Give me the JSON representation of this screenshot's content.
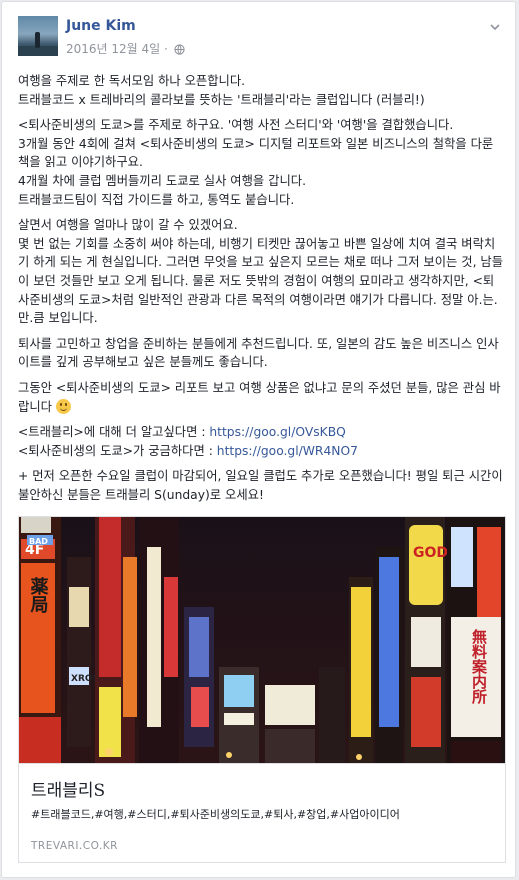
{
  "author": {
    "name": "June Kim",
    "timestamp": "2016년 12월 4일",
    "separator": "·",
    "privacy_icon": "globe-icon"
  },
  "post": {
    "p1": "여행을 주제로 한 독서모임 하나 오픈합니다.",
    "p2": "트래블코드 x 트레바리의 콜라보를 뜻하는 '트래블리'라는 클럽입니다 (러블리!)",
    "p3": "<퇴사준비생의 도쿄>를 주제로 하구요. '여행 사전 스터디'와 '여행'을 결합했습니다.",
    "p4": "3개월 동안 4회에 걸쳐 <퇴사준비생의 도쿄> 디지털 리포트와 일본 비즈니스의 철학을 다룬 책을 읽고 이야기하구요.",
    "p5": "4개월 차에 클럽 멤버들끼리 도쿄로 실사 여행을 갑니다.",
    "p6": "트래블코드팀이 직접 가이드를 하고, 통역도 붙습니다.",
    "p7": "살면서 여행을 얼마나 많이 갈 수 있겠어요.",
    "p8": "몇 번 없는 기회를 소중히 써야 하는데, 비행기 티켓만 끊어놓고 바쁜 일상에 치여 결국 벼락치기 하게 되는 게 현실입니다. 그러면 무엇을 보고 싶은지 모르는 채로 떠나 그저 보이는 것, 남들이 보던 것들만 보고 오게 됩니다. 물론 저도 뜻밖의 경험이 여행의 묘미라고 생각하지만, <퇴사준비생의 도쿄>처럼 일반적인 관광과 다른 목적의 여행이라면 얘기가 다릅니다. 정말 아.는.만.큼 보입니다.",
    "p9": "퇴사를 고민하고 창업을 준비하는 분들에게 추천드립니다. 또, 일본의 감도 높은 비즈니스 인사이트를 깊게 공부해보고 싶은 분들께도 좋습니다.",
    "p10": "그동안 <퇴사준비생의 도쿄> 리포트 보고 여행 상품은 없냐고 문의 주셨던 분들, 많은 관심 바랍니다",
    "emoji": "smile-emoji",
    "link1_label": "<트래블리>에 대해 더 알고싶다면 : ",
    "link1_url": "https://goo.gl/OVsKBQ",
    "link2_label": "<퇴사준비생의 도쿄>가 궁금하다면 : ",
    "link2_url": "https://goo.gl/WR4NO7",
    "p12": "+ 먼저 오픈한 수요일 클럽이 마감되어, 일요일 클럽도 추가로 오픈했습니다! 평일 퇴근 시간이 불안하신 분들은 트래블리 S(unday)로 오세요!"
  },
  "attachment": {
    "title": "트래블리S",
    "description": "#트래블코드,#여행,#스터디,#퇴사준비생의도쿄,#퇴사,#창업,#사업아이디어",
    "domain": "TREVARI.CO.KR",
    "image_subject": "night street with neon signboards",
    "signs": {
      "left_top": "4F",
      "left_vertical": "薬局",
      "sign_bad": "BAD",
      "sign_xross": "XROSS",
      "sign_god": "GOD",
      "sign_right": "無料案内所"
    }
  },
  "colors": {
    "link": "#365899",
    "text": "#1d2129",
    "muted": "#90949c",
    "border": "#dddfe2",
    "page_bg": "#e9ebee"
  }
}
